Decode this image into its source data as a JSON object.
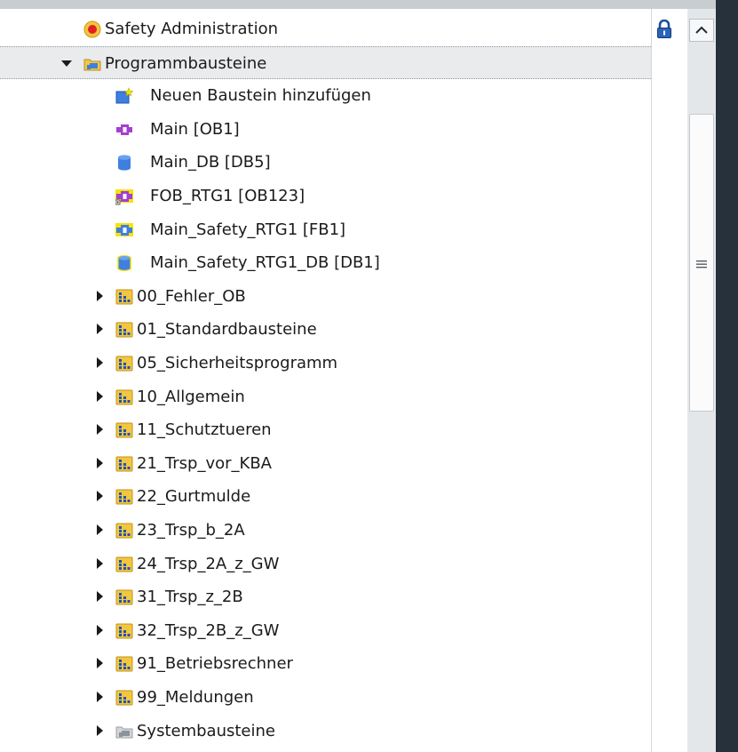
{
  "tree": {
    "items": [
      {
        "label": "Safety Administration",
        "icon": "safety-admin-icon",
        "expander": "none",
        "level": 1
      },
      {
        "label": "Programmbausteine",
        "icon": "program-blocks-folder-icon",
        "expander": "expanded",
        "level": 0,
        "selected": true
      },
      {
        "label": "Neuen Baustein hinzufügen",
        "icon": "add-new-block-icon",
        "expander": "none",
        "level": 1
      },
      {
        "label": "Main [OB1]",
        "icon": "organization-block-icon",
        "expander": "none",
        "level": 1
      },
      {
        "label": "Main_DB [DB5]",
        "icon": "data-block-icon",
        "expander": "none",
        "level": 1
      },
      {
        "label": "FOB_RTG1 [OB123]",
        "icon": "safety-organization-block-icon",
        "expander": "none",
        "level": 1
      },
      {
        "label": "Main_Safety_RTG1 [FB1]",
        "icon": "safety-function-block-icon",
        "expander": "none",
        "level": 1
      },
      {
        "label": "Main_Safety_RTG1_DB [DB1]",
        "icon": "safety-data-block-icon",
        "expander": "none",
        "level": 1
      },
      {
        "label": "00_Fehler_OB",
        "icon": "group-folder-icon",
        "expander": "collapsed",
        "level": 1
      },
      {
        "label": "01_Standardbausteine",
        "icon": "group-folder-icon",
        "expander": "collapsed",
        "level": 1
      },
      {
        "label": "05_Sicherheitsprogramm",
        "icon": "group-folder-icon",
        "expander": "collapsed",
        "level": 1
      },
      {
        "label": "10_Allgemein",
        "icon": "group-folder-icon",
        "expander": "collapsed",
        "level": 1
      },
      {
        "label": "11_Schutztueren",
        "icon": "group-folder-icon",
        "expander": "collapsed",
        "level": 1
      },
      {
        "label": "21_Trsp_vor_KBA",
        "icon": "group-folder-icon",
        "expander": "collapsed",
        "level": 1
      },
      {
        "label": "22_Gurtmulde",
        "icon": "group-folder-icon",
        "expander": "collapsed",
        "level": 1
      },
      {
        "label": "23_Trsp_b_2A",
        "icon": "group-folder-icon",
        "expander": "collapsed",
        "level": 1
      },
      {
        "label": "24_Trsp_2A_z_GW",
        "icon": "group-folder-icon",
        "expander": "collapsed",
        "level": 1
      },
      {
        "label": "31_Trsp_z_2B",
        "icon": "group-folder-icon",
        "expander": "collapsed",
        "level": 1
      },
      {
        "label": "32_Trsp_2B_z_GW",
        "icon": "group-folder-icon",
        "expander": "collapsed",
        "level": 1
      },
      {
        "label": "91_Betriebsrechner",
        "icon": "group-folder-icon",
        "expander": "collapsed",
        "level": 1
      },
      {
        "label": "99_Meldungen",
        "icon": "group-folder-icon",
        "expander": "collapsed",
        "level": 1
      },
      {
        "label": "Systembausteine",
        "icon": "system-blocks-folder-icon",
        "expander": "collapsed",
        "level": 1
      }
    ]
  },
  "lock_column": {
    "icon": "padlock-icon"
  },
  "scrollbar": {
    "up_icon": "chevron-up-icon",
    "grip_icon": "grip-icon",
    "position": 0.0
  },
  "colors": {
    "group_folder": "#f3c642",
    "organization_block": "#a43fd0",
    "data_block": "#3f7fe0",
    "safety_yellow": "#f5e400",
    "selection_bg": "#e9ebed",
    "right_dark": "#27313b"
  }
}
